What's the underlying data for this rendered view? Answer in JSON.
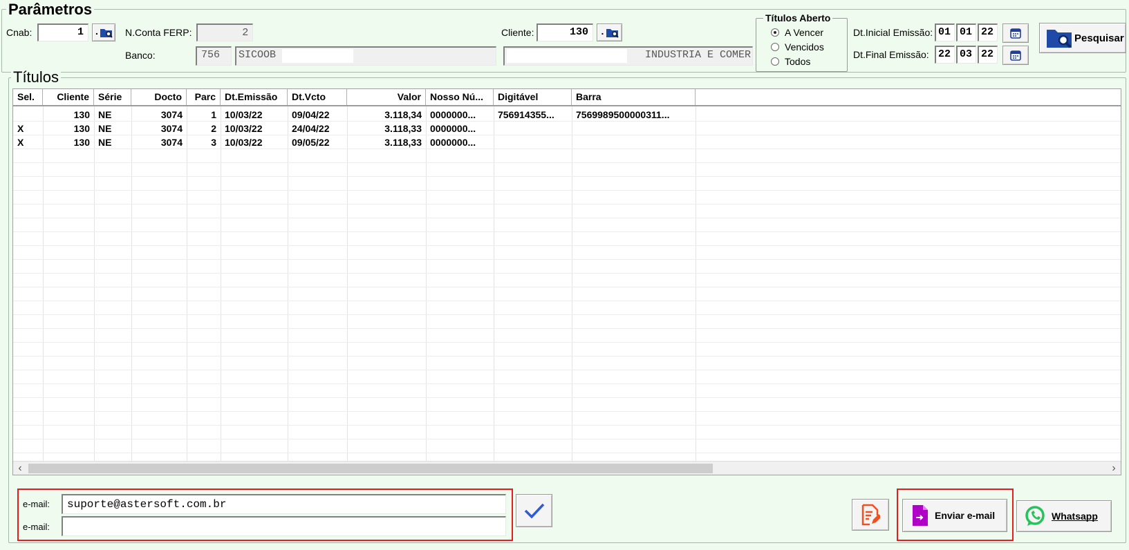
{
  "parametros": {
    "title": "Parâmetros",
    "cnab_label": "Cnab:",
    "cnab_value": "1",
    "conta_label": "N.Conta FERP:",
    "conta_value": "2",
    "banco_label": "Banco:",
    "banco_code": "756",
    "banco_name": "SICOOB",
    "cliente_label": "Cliente:",
    "cliente_value": "130",
    "cliente_name": "INDUSTRIA E COMER",
    "lookup_button": ".",
    "titulos_aberto": {
      "title": "Títulos Aberto",
      "options": [
        "A Vencer",
        "Vencidos",
        "Todos"
      ],
      "selected": "A Vencer"
    },
    "dt_inicial_label": "Dt.Inicial Emissão:",
    "dt_inicial": [
      "01",
      "01",
      "22"
    ],
    "dt_final_label": "Dt.Final Emissão:",
    "dt_final": [
      "22",
      "03",
      "22"
    ],
    "pesquisar_label": "Pesquisar"
  },
  "titulos": {
    "title": "Títulos",
    "columns": [
      "Sel.",
      "Cliente",
      "Série",
      "Docto",
      "Parc",
      "Dt.Emissão",
      "Dt.Vcto",
      "Valor",
      "Nosso Nú...",
      "Digitável",
      "Barra"
    ],
    "rows": [
      [
        "",
        "130",
        "NE",
        "3074",
        "1",
        "10/03/22",
        "09/04/22",
        "3.118,34",
        "0000000...",
        "756914355...",
        "7569989500000311..."
      ],
      [
        "X",
        "130",
        "NE",
        "3074",
        "2",
        "10/03/22",
        "24/04/22",
        "3.118,33",
        "0000000...",
        "",
        ""
      ],
      [
        "X",
        "130",
        "NE",
        "3074",
        "3",
        "10/03/22",
        "09/05/22",
        "3.118,33",
        "0000000...",
        "",
        ""
      ]
    ]
  },
  "email": {
    "label1": "e-mail:",
    "value1": "suporte@astersoft.com.br",
    "label2": "e-mail:",
    "value2": ""
  },
  "actions": {
    "enviar_email": "Enviar e-mail",
    "whatsapp": "Whatsapp"
  },
  "colors": {
    "background": "#f0fbf0",
    "highlight": "#e41e1e",
    "email_icon": "#b000c8",
    "whatsapp_icon": "#25c35a",
    "edit_icon": "#f05020",
    "calendar_icon": "#1f3f9a"
  }
}
